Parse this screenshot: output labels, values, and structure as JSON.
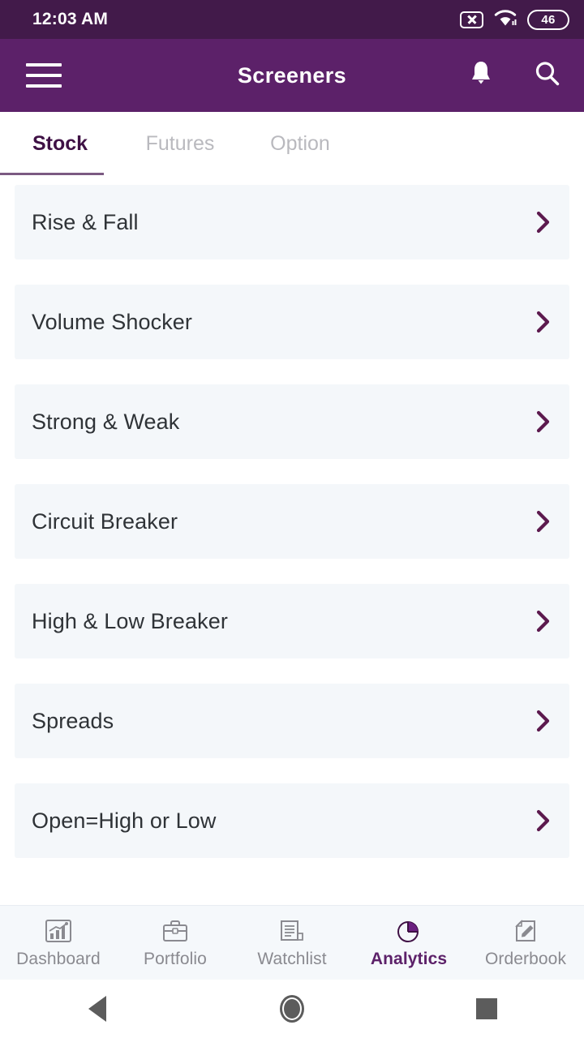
{
  "status_bar": {
    "time": "12:03 AM",
    "sim_icon": "sim-off-icon",
    "wifi_icon": "wifi-icon",
    "battery_level": "46",
    "background_color": "#421A4A"
  },
  "app_bar": {
    "menu_icon": "hamburger-menu-icon",
    "title": "Screeners",
    "notifications_icon": "bell-icon",
    "search_icon": "search-icon",
    "background_color": "#5C2169"
  },
  "tabs": {
    "items": [
      {
        "label": "Stock",
        "active": true
      },
      {
        "label": "Futures",
        "active": false
      },
      {
        "label": "Option",
        "active": false
      }
    ],
    "active_color": "#3F1145",
    "inactive_color": "#B9B9BE",
    "underline_color": "#7B5A82"
  },
  "screeners": {
    "card_color": "#F4F7FA",
    "chevron_color": "#5C1A4E",
    "items": [
      {
        "label": "Rise & Fall",
        "chevron": "chevron-right-icon"
      },
      {
        "label": "Volume Shocker",
        "chevron": "chevron-right-icon"
      },
      {
        "label": "Strong & Weak",
        "chevron": "chevron-right-icon"
      },
      {
        "label": "Circuit Breaker",
        "chevron": "chevron-right-icon"
      },
      {
        "label": "High & Low Breaker",
        "chevron": "chevron-right-icon"
      },
      {
        "label": "Spreads",
        "chevron": "chevron-right-icon"
      },
      {
        "label": "Open=High or Low",
        "chevron": "chevron-right-icon"
      }
    ]
  },
  "bottom_nav": {
    "active_color": "#5C2169",
    "inactive_color": "#8A8A90",
    "items": [
      {
        "label": "Dashboard",
        "icon": "bar-chart-icon",
        "active": false
      },
      {
        "label": "Portfolio",
        "icon": "briefcase-icon",
        "active": false
      },
      {
        "label": "Watchlist",
        "icon": "list-document-icon",
        "active": false
      },
      {
        "label": "Analytics",
        "icon": "pie-chart-icon",
        "active": true
      },
      {
        "label": "Orderbook",
        "icon": "document-edit-icon",
        "active": false
      }
    ]
  },
  "system_nav": {
    "back_icon": "triangle-back-icon",
    "home_icon": "circle-home-icon",
    "recents_icon": "square-recents-icon"
  }
}
